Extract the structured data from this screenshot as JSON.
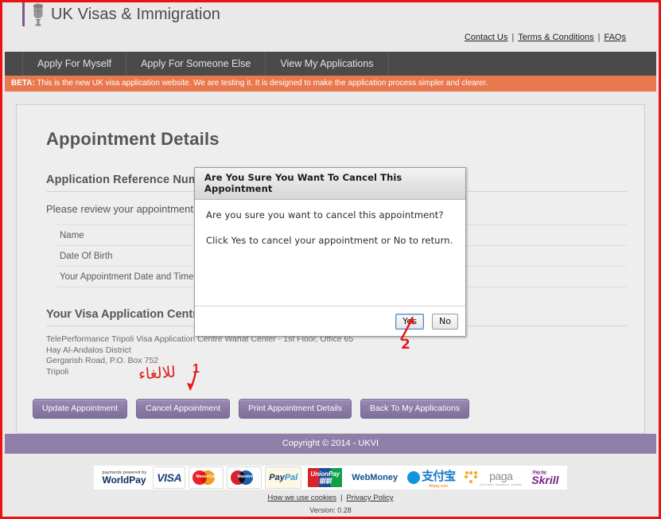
{
  "header": {
    "brand_title": "UK Visas & Immigration",
    "crest_icon": "royal-crest-icon",
    "links": [
      {
        "label": "Contact Us"
      },
      {
        "label": "Terms & Conditions"
      },
      {
        "label": "FAQs"
      }
    ],
    "separator": "|"
  },
  "nav": {
    "items": [
      {
        "label": "Apply For Myself"
      },
      {
        "label": "Apply For Someone Else"
      },
      {
        "label": "View My Applications"
      }
    ]
  },
  "beta": {
    "prefix": "BETA:",
    "message": " This is the new UK visa application website. We are testing it. It is designed to make the application process simpler and clearer."
  },
  "main": {
    "page_title": "Appointment Details",
    "reference_heading": "Application Reference Number",
    "review_text": "Please review your appointment details below",
    "detail_rows": [
      {
        "label": "Name"
      },
      {
        "label": "Date Of Birth"
      },
      {
        "label": "Your Appointment Date and Time"
      }
    ],
    "vac_heading": "Your Visa Application Centre",
    "vac_address": [
      "TelePerformance Tripoli Visa Application Centre Wahat Center - 1st Floor, Office 65",
      "Hay Al-Andalos District",
      "Gergarish Road, P.O. Box 752",
      "Tripoli"
    ],
    "actions": [
      {
        "label": "Update Appointment"
      },
      {
        "label": "Cancel Appointment"
      },
      {
        "label": "Print Appointment Details"
      },
      {
        "label": "Back To My Applications"
      }
    ]
  },
  "modal": {
    "title": "Are You Sure You Want To Cancel This Appointment",
    "line1": "Are you sure you want to cancel this appointment?",
    "line2": "Click Yes to cancel your appointment or No to return.",
    "yes_label": "Yes",
    "no_label": "No"
  },
  "annotations": {
    "arabic_note": "للالغاء",
    "marker_one": "1",
    "marker_two": "2",
    "color": "#e01b1b"
  },
  "footer": {
    "copyright": "Copyright © 2014 - UKVI",
    "payment_logos": [
      {
        "name": "worldpay",
        "top": "payments powered by",
        "text": "WorldPay"
      },
      {
        "name": "visa",
        "text": "VISA"
      },
      {
        "name": "mastercard",
        "text": "MasterCard"
      },
      {
        "name": "maestro",
        "text": "Maestro"
      },
      {
        "name": "paypal",
        "text1": "Pay",
        "text2": "Pal"
      },
      {
        "name": "unionpay",
        "text": "UnionPay",
        "sub": "银联"
      },
      {
        "name": "webmoney",
        "text": "WebMoney"
      },
      {
        "name": "alipay",
        "text": "支付宝",
        "sub": "Alipay.com"
      },
      {
        "name": "paga",
        "text": "paga",
        "sub": "your cash, anywhere, anytime"
      },
      {
        "name": "skrill",
        "top": "Pay by",
        "text": "Skrill"
      }
    ],
    "links": [
      {
        "label": "How we use cookies"
      },
      {
        "label": "Privacy Policy"
      }
    ],
    "separator": "|",
    "version": "Version: 0.28"
  },
  "colors": {
    "nav_bg": "#4a4a4a",
    "beta_bg": "#e8794e",
    "purple": "#8f7fa8",
    "button_purple": "#8b7aa6",
    "annotation_red": "#e01b1b"
  }
}
